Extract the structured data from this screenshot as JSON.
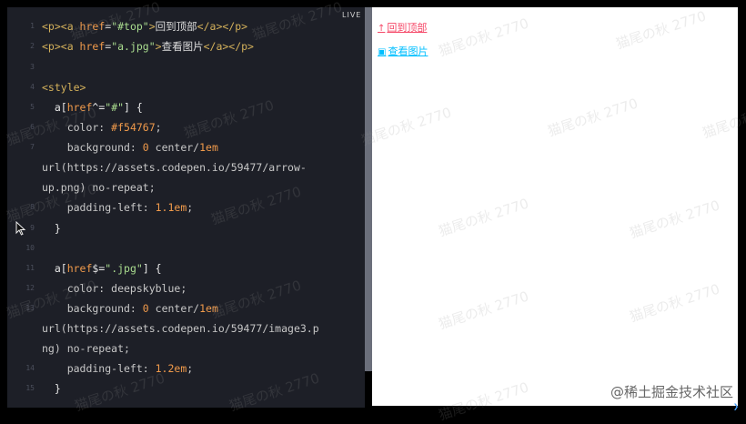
{
  "live_label": "LIVE",
  "code_lines": [
    {
      "n": "1",
      "parts": [
        [
          "tag",
          "<p><a "
        ],
        [
          "attr",
          "href"
        ],
        [
          "plain",
          "="
        ],
        [
          "str",
          "\"#top\""
        ],
        [
          "tag",
          ">"
        ],
        [
          "txt",
          "回到顶部"
        ],
        [
          "tag",
          "</a></p>"
        ]
      ]
    },
    {
      "n": "2",
      "parts": [
        [
          "tag",
          "<p><a "
        ],
        [
          "attr",
          "href"
        ],
        [
          "plain",
          "="
        ],
        [
          "str",
          "\"a.jpg\""
        ],
        [
          "tag",
          ">"
        ],
        [
          "txt",
          "查看图片"
        ],
        [
          "tag",
          "</a></p>"
        ]
      ]
    },
    {
      "n": "3",
      "parts": []
    },
    {
      "n": "4",
      "parts": [
        [
          "tag",
          "<style>"
        ]
      ]
    },
    {
      "n": "5",
      "parts": [
        [
          "sel",
          "  a["
        ],
        [
          "attr",
          "href"
        ],
        [
          "sel",
          "^="
        ],
        [
          "str",
          "\"#\""
        ],
        [
          "sel",
          "] {"
        ]
      ]
    },
    {
      "n": "6",
      "parts": [
        [
          "prop",
          "    color: "
        ],
        [
          "hex",
          "#f54767"
        ],
        [
          "prop",
          ";"
        ]
      ]
    },
    {
      "n": "7",
      "parts": [
        [
          "prop",
          "    background: "
        ],
        [
          "num",
          "0"
        ],
        [
          "prop",
          " center/"
        ],
        [
          "num",
          "1em"
        ]
      ]
    },
    {
      "n": "",
      "parts": [
        [
          "prop",
          "url(https://assets.codepen.io/59477/arrow-"
        ]
      ]
    },
    {
      "n": "",
      "parts": [
        [
          "prop",
          "up.png) no-repeat;"
        ]
      ]
    },
    {
      "n": "8",
      "parts": [
        [
          "prop",
          "    padding-left: "
        ],
        [
          "num",
          "1.1em"
        ],
        [
          "prop",
          ";"
        ]
      ]
    },
    {
      "n": "9",
      "parts": [
        [
          "sel",
          "  }"
        ]
      ]
    },
    {
      "n": "10",
      "parts": []
    },
    {
      "n": "11",
      "parts": [
        [
          "sel",
          "  a["
        ],
        [
          "attr",
          "href"
        ],
        [
          "sel",
          "$="
        ],
        [
          "str",
          "\".jpg\""
        ],
        [
          "sel",
          "] {"
        ]
      ]
    },
    {
      "n": "12",
      "parts": [
        [
          "prop",
          "    color: deepskyblue;"
        ]
      ]
    },
    {
      "n": "13",
      "parts": [
        [
          "prop",
          "    background: "
        ],
        [
          "num",
          "0"
        ],
        [
          "prop",
          " center/"
        ],
        [
          "num",
          "1em"
        ]
      ]
    },
    {
      "n": "",
      "parts": [
        [
          "prop",
          "url(https://assets.codepen.io/59477/image3.p"
        ]
      ]
    },
    {
      "n": "",
      "parts": [
        [
          "prop",
          "ng) no-repeat;"
        ]
      ]
    },
    {
      "n": "14",
      "parts": [
        [
          "prop",
          "    padding-left: "
        ],
        [
          "num",
          "1.2em"
        ],
        [
          "prop",
          ";"
        ]
      ]
    },
    {
      "n": "15",
      "parts": [
        [
          "sel",
          "  }"
        ]
      ]
    }
  ],
  "preview": {
    "link_top": {
      "icon": "↑",
      "label": "回到顶部",
      "color": "#f54767"
    },
    "link_image": {
      "icon": "▣",
      "label": "查看图片",
      "color": "#00bfff"
    }
  },
  "watermark": "猫尾の秋 2770",
  "credit": "@稀土掘金技术社区"
}
